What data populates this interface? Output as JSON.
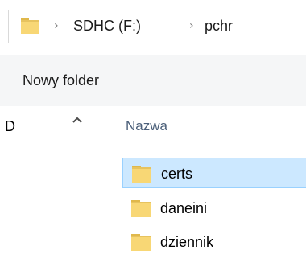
{
  "address_bar": {
    "breadcrumbs": [
      "SDHC (F:)",
      "pchr"
    ],
    "separator_icon": "chevron-right-icon",
    "folder_icon": "folder-icon"
  },
  "toolbar": {
    "new_folder_label": "Nowy folder"
  },
  "nav_pane": {
    "drive_letter": "D",
    "chevron_icon": "chevron-up-icon"
  },
  "file_list": {
    "column_header": "Nazwa",
    "items": [
      {
        "label": "certs",
        "selected": true,
        "icon": "folder-icon"
      },
      {
        "label": "daneini",
        "selected": false,
        "icon": "folder-icon"
      },
      {
        "label": "dziennik",
        "selected": false,
        "icon": "folder-icon"
      }
    ]
  },
  "colors": {
    "folder_yellow": "#f8d775",
    "folder_shadow": "#e0b84b",
    "selection_bg": "#cce8ff",
    "selection_border": "#99d1ff",
    "header_text": "#4c607a",
    "toolbar_bg": "#f5f6f7"
  }
}
